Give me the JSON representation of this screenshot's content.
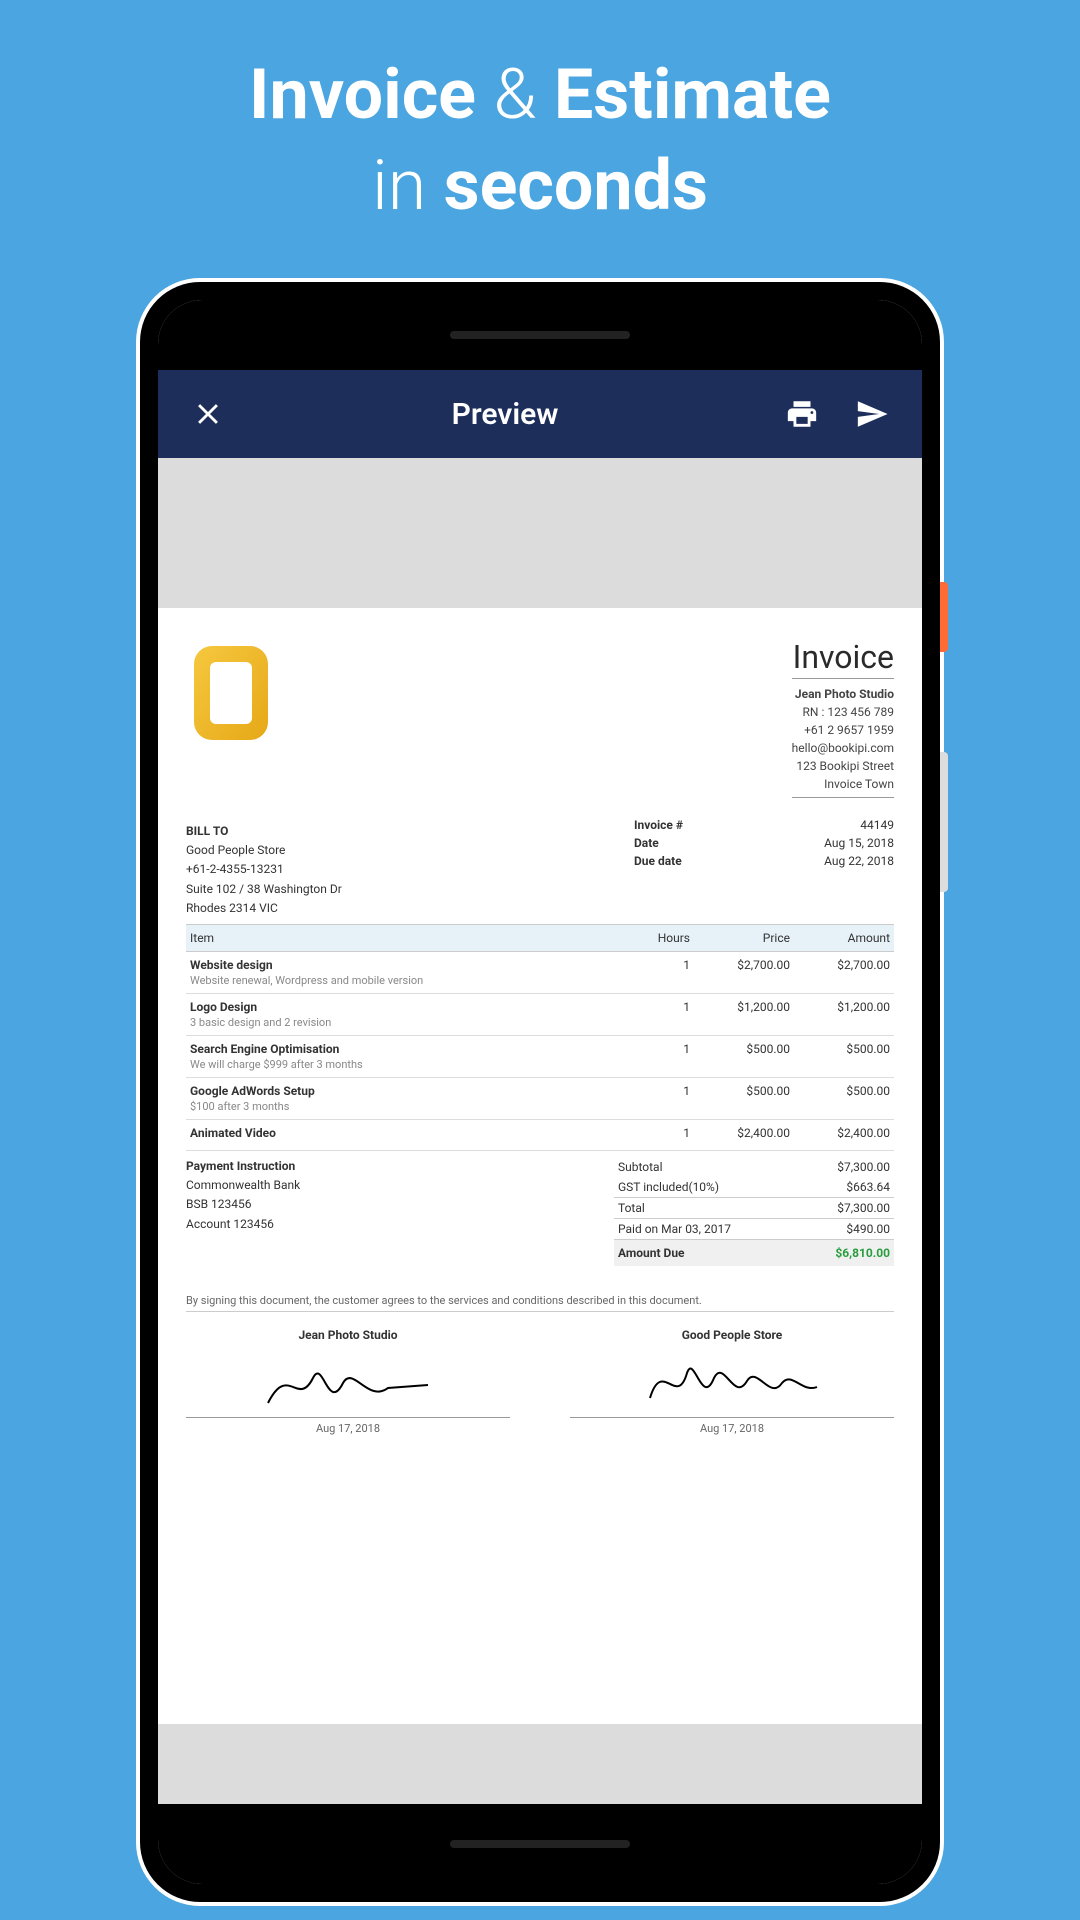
{
  "hero": {
    "line1_bold_a": "Invoice",
    "line1_amp": "&",
    "line1_bold_b": "Estimate",
    "line2_light": "in",
    "line2_bold": "seconds"
  },
  "appbar": {
    "title": "Preview"
  },
  "invoice": {
    "title": "Invoice",
    "company": {
      "name": "Jean Photo Studio",
      "rn": "RN : 123 456 789",
      "phone": "+61 2 9657 1959",
      "email": "hello@bookipi.com",
      "street": "123 Bookipi Street",
      "city": "Invoice Town"
    },
    "bill_to": {
      "heading": "BILL TO",
      "name": "Good People Store",
      "phone": "+61-2-4355-13231",
      "addr1": "Suite 102 / 38 Washington Dr",
      "addr2": "Rhodes 2314 VIC"
    },
    "meta": {
      "inv_no_label": "Invoice #",
      "inv_no": "44149",
      "date_label": "Date",
      "date": "Aug 15, 2018",
      "due_label": "Due date",
      "due": "Aug 22, 2018"
    },
    "cols": {
      "item": "Item",
      "hours": "Hours",
      "price": "Price",
      "amount": "Amount"
    },
    "items": [
      {
        "name": "Website design",
        "desc": "Website renewal, Wordpress and mobile version",
        "hours": "1",
        "price": "$2,700.00",
        "amount": "$2,700.00"
      },
      {
        "name": "Logo Design",
        "desc": "3 basic design and 2 revision",
        "hours": "1",
        "price": "$1,200.00",
        "amount": "$1,200.00"
      },
      {
        "name": "Search Engine Optimisation",
        "desc": "We will charge $999 after 3 months",
        "hours": "1",
        "price": "$500.00",
        "amount": "$500.00"
      },
      {
        "name": "Google AdWords Setup",
        "desc": "$100 after 3 months",
        "hours": "1",
        "price": "$500.00",
        "amount": "$500.00"
      },
      {
        "name": "Animated Video",
        "desc": "",
        "hours": "1",
        "price": "$2,400.00",
        "amount": "$2,400.00"
      }
    ],
    "payment": {
      "heading": "Payment Instruction",
      "bank": "Commonwealth Bank",
      "bsb": "BSB 123456",
      "acct": "Account 123456"
    },
    "totals": {
      "subtotal_label": "Subtotal",
      "subtotal": "$7,300.00",
      "gst_label": "GST included(10%)",
      "gst": "$663.64",
      "total_label": "Total",
      "total": "$7,300.00",
      "paid_label": "Paid on Mar 03, 2017",
      "paid": "$490.00",
      "due_label": "Amount Due",
      "due": "$6,810.00"
    },
    "disclaimer": "By signing this document, the customer agrees to the services and conditions described in this document.",
    "sign": {
      "left_name": "Jean Photo Studio",
      "left_date": "Aug 17, 2018",
      "right_name": "Good People Store",
      "right_date": "Aug 17, 2018"
    }
  }
}
